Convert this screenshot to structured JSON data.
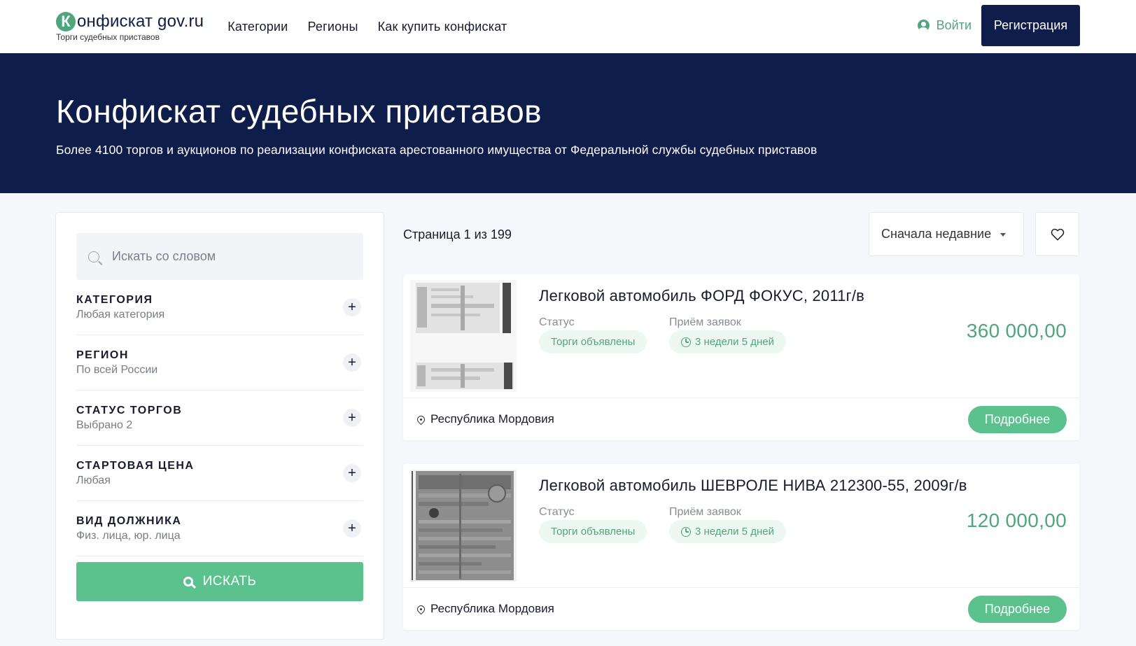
{
  "header": {
    "logo_letter": "К",
    "logo_name": "онфискат gov.ru",
    "logo_sub": "Торги судебных приставов",
    "nav": [
      "Категории",
      "Регионы",
      "Как купить конфискат"
    ],
    "login_label": "Войти",
    "register_label": "Регистрация"
  },
  "hero": {
    "title": "Конфискат судебных приставов",
    "subtitle": "Более 4100 торгов и аукционов по реализации конфиската арестованного имущества от Федеральной службы судебных приставов"
  },
  "sidebar": {
    "search_placeholder": "Искать со словом",
    "filters": [
      {
        "title": "КАТЕГОРИЯ",
        "value": "Любая категория"
      },
      {
        "title": "РЕГИОН",
        "value": "По всей России"
      },
      {
        "title": "СТАТУС ТОРГОВ",
        "value": "Выбрано 2"
      },
      {
        "title": "СТАРТОВАЯ ЦЕНА",
        "value": "Любая"
      },
      {
        "title": "ВИД ДОЛЖНИКА",
        "value": "Физ. лица, юр. лица"
      }
    ],
    "search_button": "ИСКАТЬ"
  },
  "results": {
    "page_info": "Страница 1 из 199",
    "sort_label": "Сначала недавние",
    "cards": [
      {
        "title": "Легковой автомобиль ФОРД ФОКУС, 2011г/в",
        "status_label": "Статус",
        "status_value": "Торги объявлены",
        "deadline_label": "Приём заявок",
        "deadline_value": "3 недели 5 дней",
        "price": "360 000,00",
        "location": "Республика Мордовия",
        "more_label": "Подробнее"
      },
      {
        "title": "Легковой автомобиль ШЕВРОЛЕ НИВА 212300-55, 2009г/в",
        "status_label": "Статус",
        "status_value": "Торги объявлены",
        "deadline_label": "Приём заявок",
        "deadline_value": "3 недели 5 дней",
        "price": "120 000,00",
        "location": "Республика Мордовия",
        "more_label": "Подробнее"
      }
    ]
  },
  "colors": {
    "navy": "#0f1d4a",
    "green": "#5cc28d",
    "green_text": "#4fa67e"
  }
}
